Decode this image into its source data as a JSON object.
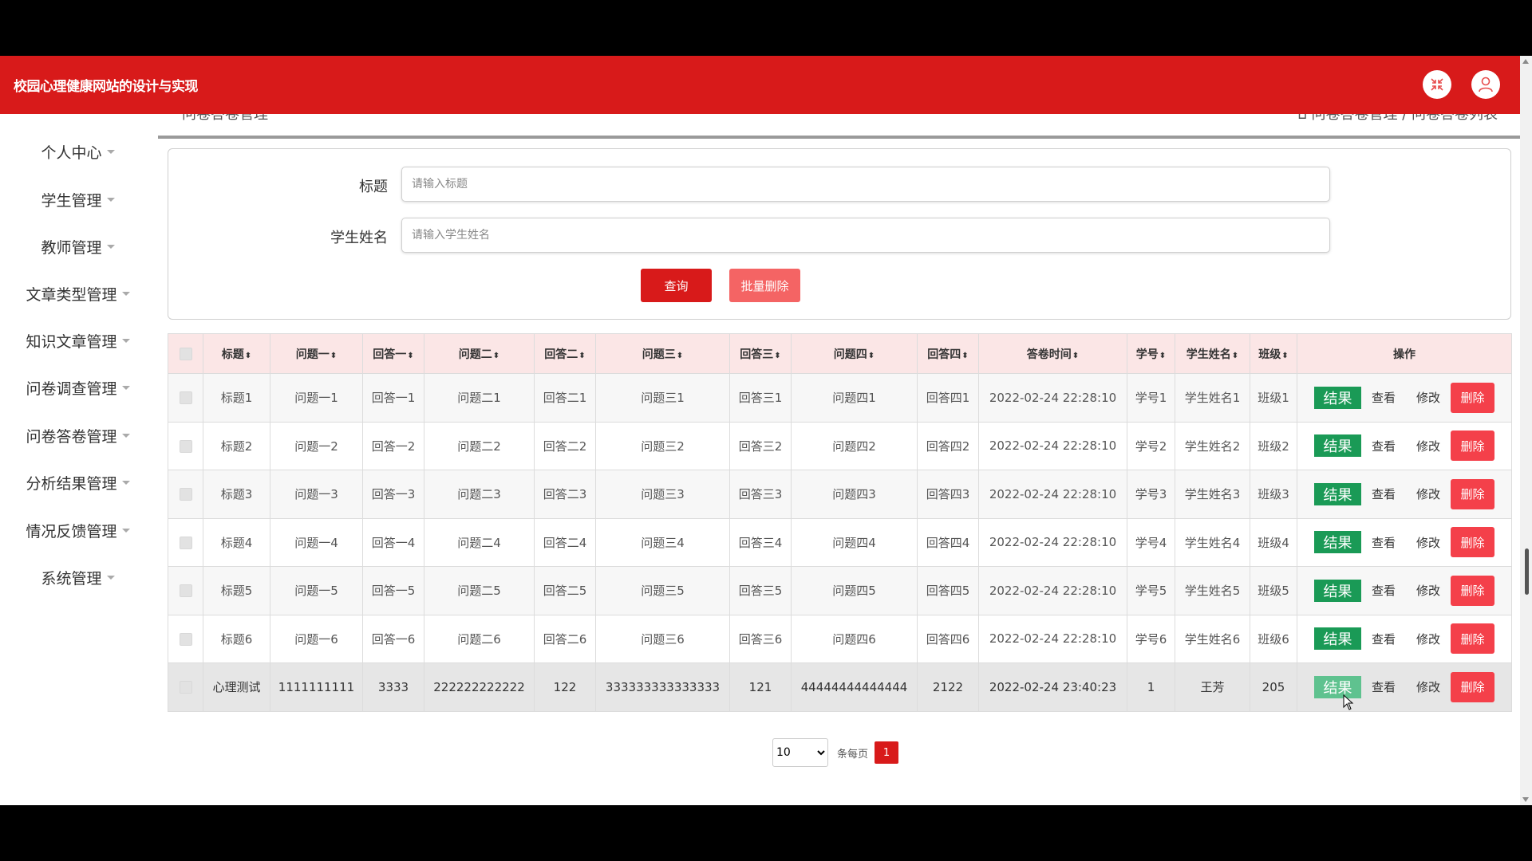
{
  "header": {
    "site_title": "校园心理健康网站的设计与实现"
  },
  "sidebar": {
    "items": [
      {
        "label": "个人中心"
      },
      {
        "label": "学生管理"
      },
      {
        "label": "教师管理"
      },
      {
        "label": "文章类型管理"
      },
      {
        "label": "知识文章管理"
      },
      {
        "label": "问卷调查管理"
      },
      {
        "label": "问卷答卷管理"
      },
      {
        "label": "分析结果管理"
      },
      {
        "label": "情况反馈管理"
      },
      {
        "label": "系统管理"
      }
    ]
  },
  "breadcrumb": {
    "left": "问卷答卷管理",
    "right": "问卷答卷管理 / 问卷答卷列表"
  },
  "search": {
    "title_label": "标题",
    "title_placeholder": "请输入标题",
    "name_label": "学生姓名",
    "name_placeholder": "请输入学生姓名",
    "query_button": "查询",
    "batch_delete_button": "批量删除"
  },
  "table": {
    "columns": [
      "标题",
      "问题一",
      "回答一",
      "问题二",
      "回答二",
      "问题三",
      "回答三",
      "问题四",
      "回答四",
      "答卷时间",
      "学号",
      "学生姓名",
      "班级"
    ],
    "ops_header": "操作",
    "sort_glyph": "⬍",
    "actions": {
      "result": "结果",
      "view": "查看",
      "edit": "修改",
      "delete": "删除"
    },
    "rows": [
      [
        "标题1",
        "问题一1",
        "回答一1",
        "问题二1",
        "回答二1",
        "问题三1",
        "回答三1",
        "问题四1",
        "回答四1",
        "2022-02-24 22:28:10",
        "学号1",
        "学生姓名1",
        "班级1"
      ],
      [
        "标题2",
        "问题一2",
        "回答一2",
        "问题二2",
        "回答二2",
        "问题三2",
        "回答三2",
        "问题四2",
        "回答四2",
        "2022-02-24 22:28:10",
        "学号2",
        "学生姓名2",
        "班级2"
      ],
      [
        "标题3",
        "问题一3",
        "回答一3",
        "问题二3",
        "回答二3",
        "问题三3",
        "回答三3",
        "问题四3",
        "回答四3",
        "2022-02-24 22:28:10",
        "学号3",
        "学生姓名3",
        "班级3"
      ],
      [
        "标题4",
        "问题一4",
        "回答一4",
        "问题二4",
        "回答二4",
        "问题三4",
        "回答三4",
        "问题四4",
        "回答四4",
        "2022-02-24 22:28:10",
        "学号4",
        "学生姓名4",
        "班级4"
      ],
      [
        "标题5",
        "问题一5",
        "回答一5",
        "问题二5",
        "回答二5",
        "问题三5",
        "回答三5",
        "问题四5",
        "回答四5",
        "2022-02-24 22:28:10",
        "学号5",
        "学生姓名5",
        "班级5"
      ],
      [
        "标题6",
        "问题一6",
        "回答一6",
        "问题二6",
        "回答二6",
        "问题三6",
        "回答三6",
        "问题四6",
        "回答四6",
        "2022-02-24 22:28:10",
        "学号6",
        "学生姓名6",
        "班级6"
      ],
      [
        "心理测试",
        "1111111111",
        "3333",
        "222222222222",
        "122",
        "333333333333333",
        "121",
        "44444444444444",
        "2122",
        "2022-02-24 23:40:23",
        "1",
        "王芳",
        "205"
      ]
    ]
  },
  "pagination": {
    "page_size": "10",
    "page_size_options": [
      "10"
    ],
    "per_page_label": "条每页",
    "current_page": "1"
  },
  "colors": {
    "brand_red": "#d81a1a",
    "result_green": "#1a9a56",
    "delete_red": "#f4404a"
  }
}
